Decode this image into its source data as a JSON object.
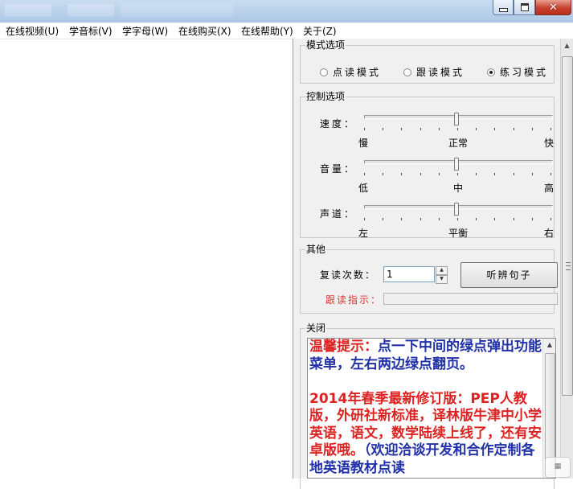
{
  "window": {
    "controls": [
      "minimize-icon",
      "maximize-icon",
      "close-icon"
    ]
  },
  "menu": [
    "在线视频(U)",
    "学音标(V)",
    "学字母(W)",
    "在线购买(X)",
    "在线帮助(Y)",
    "关于(Z)"
  ],
  "mode_options": {
    "label": "模式选项",
    "options": [
      "点读模式",
      "跟读模式",
      "练习模式"
    ],
    "selected": "练习模式"
  },
  "control_options": {
    "label": "控制选项",
    "speed": {
      "label": "速度：",
      "scale": [
        "慢",
        "正常",
        "快"
      ],
      "level": 0.5
    },
    "volume": {
      "label": "音量：",
      "scale": [
        "低",
        "中",
        "高"
      ],
      "level": 0.5
    },
    "channel": {
      "label": "声道：",
      "scale": [
        "左",
        "平衡",
        "右"
      ],
      "level": 0.5
    }
  },
  "other": {
    "label": "其他",
    "repeat_label": "复读次数：",
    "repeat_value": "1",
    "listen_button": "听辨句子",
    "indicator_label": "跟读指示："
  },
  "close_group": {
    "label": "关闭"
  },
  "tip": {
    "heading": "温馨提示：",
    "line1": "点一下中间的绿点弹出功能菜单，左右两边绿点翻页。",
    "para2_red": "2014年春季最新修订版：PEP人教版，外研社新标准，译林版牛津中小学英语，语文，数学陆续上线了，还有安卓版哦。",
    "para2_blue": "（欢迎洽谈开发和合作定制各地英语教材点读"
  },
  "colors": {
    "tip_red": "#dd2222",
    "tip_blue": "#2030a8",
    "indicator_red": "#e03030"
  }
}
